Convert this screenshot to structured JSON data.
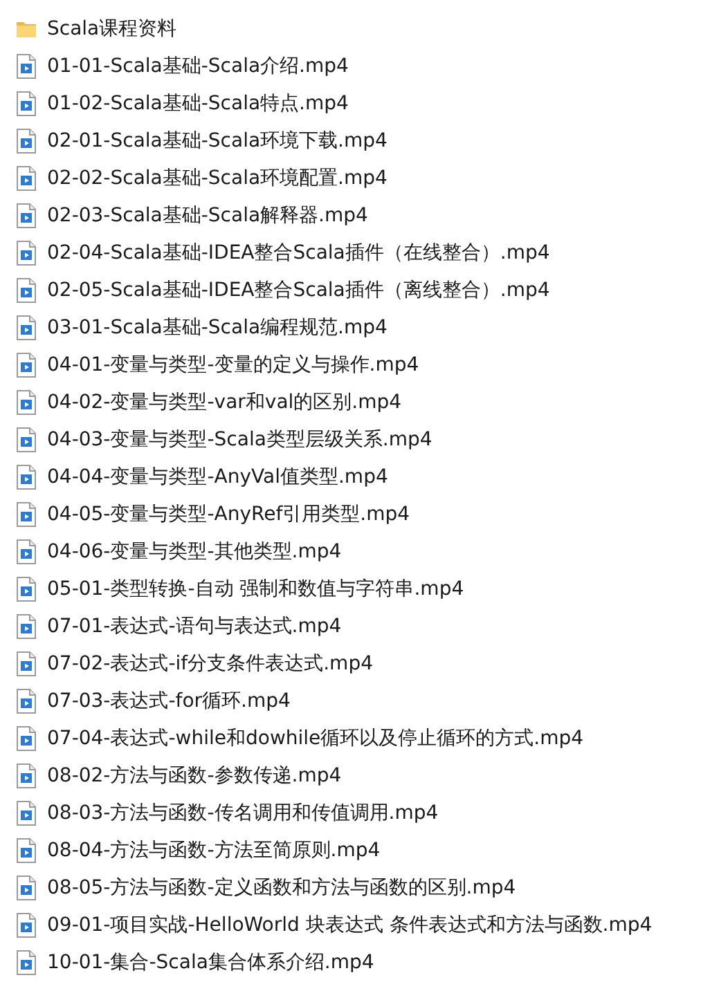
{
  "files": [
    {
      "kind": "folder",
      "name": "Scala课程资料"
    },
    {
      "kind": "video",
      "name": "01-01-Scala基础-Scala介绍.mp4"
    },
    {
      "kind": "video",
      "name": "01-02-Scala基础-Scala特点.mp4"
    },
    {
      "kind": "video",
      "name": "02-01-Scala基础-Scala环境下载.mp4"
    },
    {
      "kind": "video",
      "name": "02-02-Scala基础-Scala环境配置.mp4"
    },
    {
      "kind": "video",
      "name": "02-03-Scala基础-Scala解释器.mp4"
    },
    {
      "kind": "video",
      "name": "02-04-Scala基础-IDEA整合Scala插件（在线整合）.mp4"
    },
    {
      "kind": "video",
      "name": "02-05-Scala基础-IDEA整合Scala插件（离线整合）.mp4"
    },
    {
      "kind": "video",
      "name": "03-01-Scala基础-Scala编程规范.mp4"
    },
    {
      "kind": "video",
      "name": "04-01-变量与类型-变量的定义与操作.mp4"
    },
    {
      "kind": "video",
      "name": "04-02-变量与类型-var和val的区别.mp4"
    },
    {
      "kind": "video",
      "name": "04-03-变量与类型-Scala类型层级关系.mp4"
    },
    {
      "kind": "video",
      "name": "04-04-变量与类型-AnyVal值类型.mp4"
    },
    {
      "kind": "video",
      "name": "04-05-变量与类型-AnyRef引用类型.mp4"
    },
    {
      "kind": "video",
      "name": "04-06-变量与类型-其他类型.mp4"
    },
    {
      "kind": "video",
      "name": "05-01-类型转换-自动 强制和数值与字符串.mp4"
    },
    {
      "kind": "video",
      "name": "07-01-表达式-语句与表达式.mp4"
    },
    {
      "kind": "video",
      "name": "07-02-表达式-if分支条件表达式.mp4"
    },
    {
      "kind": "video",
      "name": "07-03-表达式-for循环.mp4"
    },
    {
      "kind": "video",
      "name": "07-04-表达式-while和dowhile循环以及停止循环的方式.mp4"
    },
    {
      "kind": "video",
      "name": "08-02-方法与函数-参数传递.mp4"
    },
    {
      "kind": "video",
      "name": "08-03-方法与函数-传名调用和传值调用.mp4"
    },
    {
      "kind": "video",
      "name": "08-04-方法与函数-方法至简原则.mp4"
    },
    {
      "kind": "video",
      "name": "08-05-方法与函数-定义函数和方法与函数的区别.mp4"
    },
    {
      "kind": "video",
      "name": "09-01-项目实战-HelloWorld 块表达式 条件表达式和方法与函数.mp4"
    },
    {
      "kind": "video",
      "name": "10-01-集合-Scala集合体系介绍.mp4"
    }
  ]
}
